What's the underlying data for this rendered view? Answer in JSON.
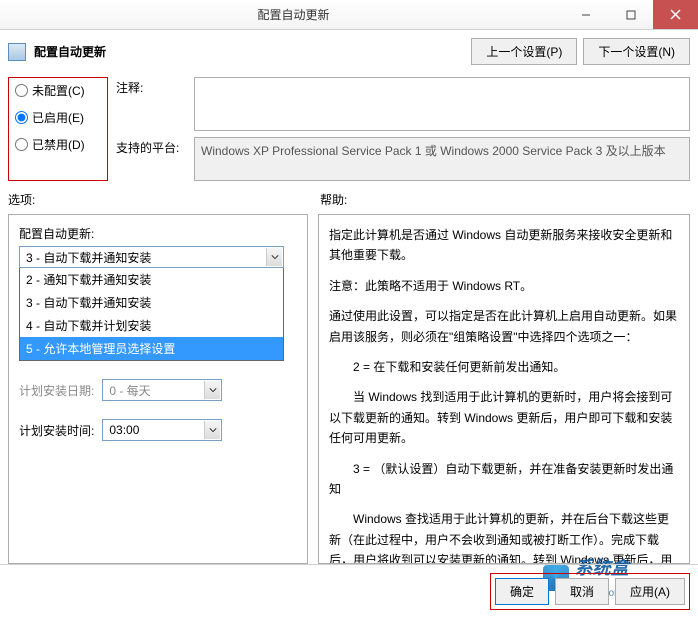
{
  "titlebar": {
    "title": "配置自动更新"
  },
  "header": {
    "policy_title": "配置自动更新",
    "prev_btn": "上一个设置(P)",
    "next_btn": "下一个设置(N)"
  },
  "radios": {
    "not_configured": "未配置(C)",
    "enabled": "已启用(E)",
    "disabled": "已禁用(D)"
  },
  "comment": {
    "label": "注释:",
    "value": ""
  },
  "supported": {
    "label": "支持的平台:",
    "value": "Windows XP Professional Service Pack 1 或 Windows 2000 Service Pack 3 及以上版本"
  },
  "options_header": "选项:",
  "help_header": "帮助:",
  "left": {
    "field_label": "配置自动更新:",
    "selected": "3 - 自动下载并通知安装",
    "options": [
      "2 - 通知下载并通知安装",
      "3 - 自动下载并通知安装",
      "4 - 自动下载并计划安装",
      "5 - 允许本地管理员选择设置"
    ],
    "highlight_index": 3,
    "schedule_day_label": "计划安装日期:",
    "schedule_day_value": "0 - 每天",
    "schedule_time_label": "计划安装时间:",
    "schedule_time_value": "03:00"
  },
  "help": {
    "p1": "指定此计算机是否通过 Windows 自动更新服务来接收安全更新和其他重要下载。",
    "p2": "注意：此策略不适用于 Windows RT。",
    "p3": "通过使用此设置，可以指定是否在此计算机上启用自动更新。如果启用该服务，则必须在\"组策略设置\"中选择四个选项之一：",
    "p4": "　　2 = 在下载和安装任何更新前发出通知。",
    "p5": "　　当 Windows 找到适用于此计算机的更新时，用户将会接到可以下载更新的通知。转到 Windows 更新后，用户即可下载和安装任何可用更新。",
    "p6": "　　3 = （默认设置）自动下载更新，并在准备安装更新时发出通知",
    "p7": "　　Windows 查找适用于此计算机的更新，并在后台下载这些更新（在此过程中，用户不会收到通知或被打断工作）。完成下载后，用户将收到可以安装更新的通知。转到 Windows 更新后，用户即可安装更新。"
  },
  "footer": {
    "ok": "确定",
    "cancel": "取消",
    "apply": "应用(A)"
  },
  "watermark": {
    "text": "系统盒",
    "url": "www.xitonghe.com"
  }
}
